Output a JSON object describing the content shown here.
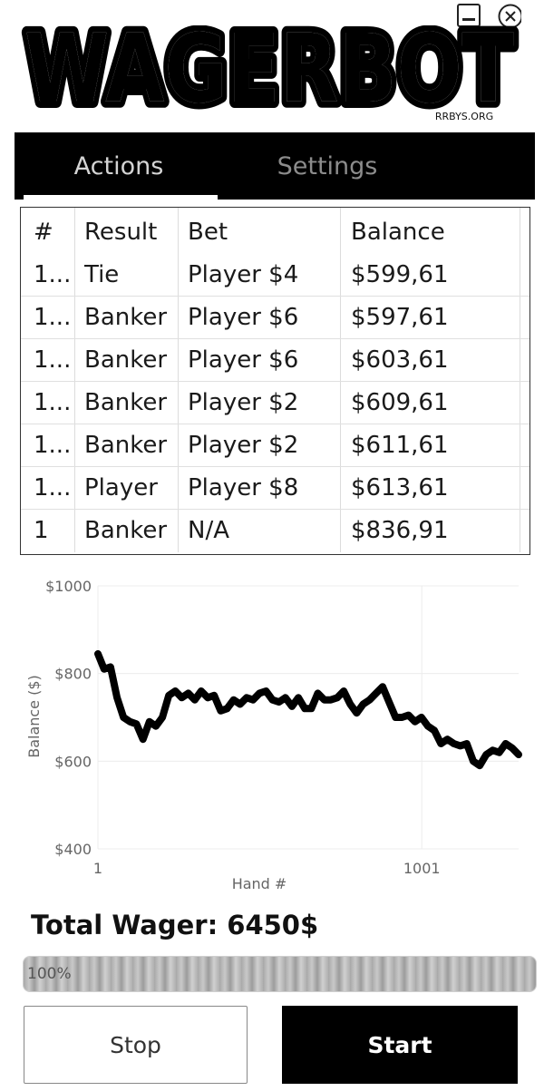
{
  "window": {
    "minimize_icon": "minimize-icon",
    "close_icon": "close-icon"
  },
  "logo": {
    "text": "WAGERBOT",
    "subtext": "RRBYS.ORG"
  },
  "tabs": [
    {
      "label": "Actions",
      "active": true
    },
    {
      "label": "Settings",
      "active": false
    }
  ],
  "table": {
    "columns": [
      "#",
      "Result",
      "Bet",
      "Balance"
    ],
    "rows": [
      [
        "1...",
        "Tie",
        "Player $4",
        "$599,61"
      ],
      [
        "1...",
        "Banker",
        "Player $6",
        "$597,61"
      ],
      [
        "1...",
        "Banker",
        "Player $6",
        "$603,61"
      ],
      [
        "1...",
        "Banker",
        "Player $2",
        "$609,61"
      ],
      [
        "1...",
        "Banker",
        "Player $2",
        "$611,61"
      ],
      [
        "1...",
        "Player",
        "Player $8",
        "$613,61"
      ],
      [
        "1",
        "Banker",
        "N/A",
        "$836,91"
      ]
    ]
  },
  "chart_data": {
    "type": "line",
    "xlabel": "Hand #",
    "ylabel": "Balance ($)",
    "ylim": [
      400,
      1000
    ],
    "xlim": [
      1,
      1300
    ],
    "x_ticks": [
      "1",
      "1001"
    ],
    "y_ticks": [
      "$1000",
      "$800",
      "$600",
      "$400"
    ],
    "grid": true,
    "series": [
      {
        "x": [
          1,
          20,
          40,
          60,
          80,
          100,
          120,
          140,
          160,
          180,
          200,
          220,
          240,
          260,
          280,
          300,
          320,
          340,
          360,
          380,
          400,
          420,
          440,
          460,
          480,
          500,
          520,
          540,
          560,
          580,
          600,
          620,
          640,
          660,
          680,
          700,
          720,
          740,
          760,
          780,
          800,
          820,
          840,
          860,
          880,
          900,
          920,
          940,
          960,
          980,
          1000,
          1020,
          1040,
          1060,
          1080,
          1100,
          1120,
          1140,
          1160,
          1180,
          1200,
          1220,
          1240,
          1260,
          1280,
          1300
        ],
        "values": [
          845,
          810,
          815,
          745,
          700,
          690,
          685,
          650,
          690,
          680,
          700,
          750,
          760,
          745,
          755,
          740,
          760,
          745,
          750,
          715,
          720,
          740,
          730,
          745,
          740,
          755,
          760,
          740,
          735,
          745,
          725,
          745,
          720,
          720,
          755,
          740,
          740,
          745,
          760,
          730,
          710,
          730,
          740,
          755,
          770,
          735,
          700,
          700,
          705,
          690,
          700,
          680,
          670,
          640,
          650,
          640,
          635,
          640,
          600,
          590,
          615,
          625,
          620,
          640,
          630,
          615
        ]
      }
    ]
  },
  "summary": {
    "total_wager_text": "Total Wager: 6450$"
  },
  "progress": {
    "value_percent": 100,
    "label": "100%"
  },
  "buttons": {
    "stop_label": "Stop",
    "start_label": "Start"
  }
}
